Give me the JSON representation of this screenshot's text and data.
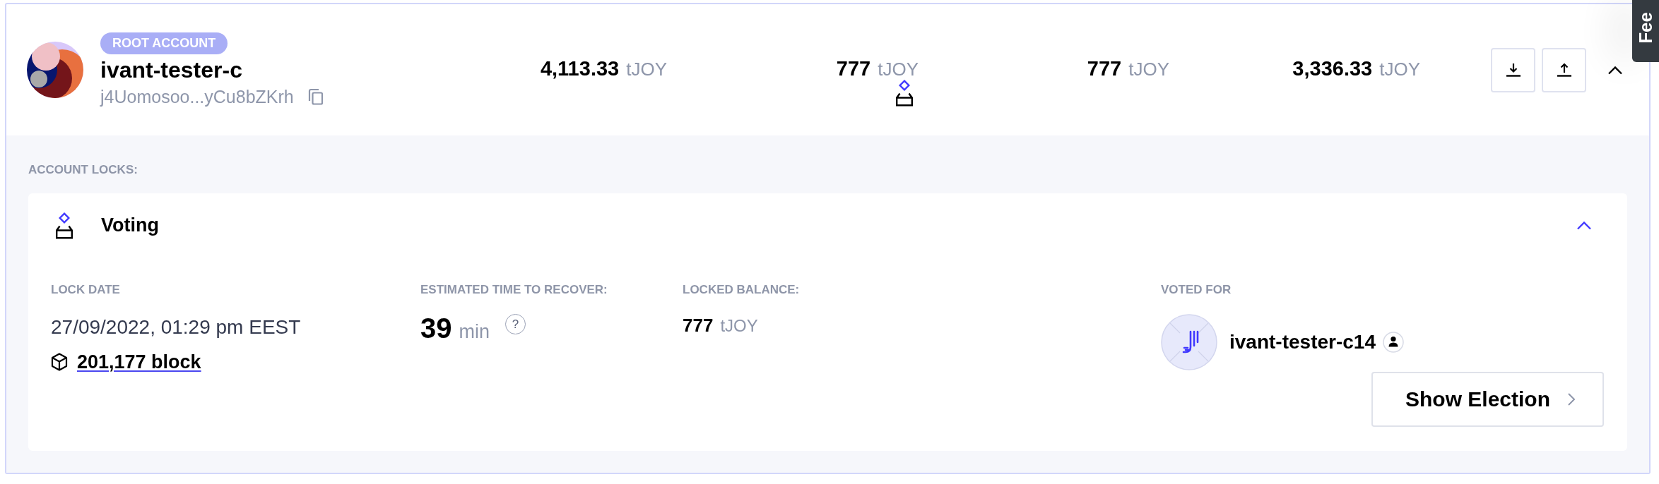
{
  "account": {
    "badge": "ROOT ACCOUNT",
    "name": "ivant-tester-c",
    "address": "j4Uomosoo...yCu8bZKrh",
    "expanded": true
  },
  "balances": [
    {
      "amount": "4,113.33",
      "unit": "tJOY",
      "locked": false
    },
    {
      "amount": "777",
      "unit": "tJOY",
      "locked": true
    },
    {
      "amount": "777",
      "unit": "tJOY",
      "locked": false
    },
    {
      "amount": "3,336.33",
      "unit": "tJOY",
      "locked": false
    }
  ],
  "locks_section": {
    "title": "ACCOUNT LOCKS:",
    "locks": [
      {
        "kind": "voting",
        "title": "Voting",
        "expanded": true,
        "lock_date": {
          "label": "LOCK DATE",
          "value": "27/09/2022, 01:29 pm EEST",
          "block": "201,177 block"
        },
        "recovery": {
          "label": "ESTIMATED TIME TO RECOVER:",
          "value": "39",
          "unit": "min",
          "hint": "?"
        },
        "locked_balance": {
          "label": "LOCKED BALANCE:",
          "amount": "777",
          "unit": "tJOY"
        },
        "voted_for": {
          "label": "VOTED FOR",
          "name": "ivant-tester-c14",
          "button": "Show Election"
        }
      }
    ]
  },
  "side_tab": {
    "label": "Fee"
  }
}
